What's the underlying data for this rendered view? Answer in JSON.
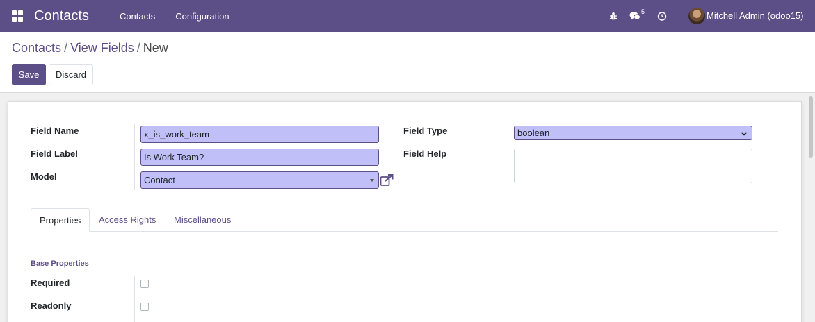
{
  "navbar": {
    "app_name": "Contacts",
    "menu": [
      "Contacts",
      "Configuration"
    ],
    "chat_count": "5",
    "user_name": "Mitchell Admin (odoo15)",
    "color": "#5c4e86"
  },
  "breadcrumb": {
    "items": [
      "Contacts",
      "View Fields"
    ],
    "separator": "/",
    "current": "New"
  },
  "actions": {
    "save_label": "Save",
    "discard_label": "Discard"
  },
  "form": {
    "field_name_label": "Field Name",
    "field_name_value": "x_is_work_team",
    "field_label_label": "Field Label",
    "field_label_value": "Is Work Team?",
    "model_label": "Model",
    "model_value": "Contact",
    "field_type_label": "Field Type",
    "field_type_value": "boolean",
    "field_help_label": "Field Help",
    "field_help_value": ""
  },
  "tabs": [
    {
      "label": "Properties",
      "active": true
    },
    {
      "label": "Access Rights",
      "active": false
    },
    {
      "label": "Miscellaneous",
      "active": false
    }
  ],
  "base_properties": {
    "title": "Base Properties",
    "required_label": "Required",
    "required_checked": false,
    "readonly_label": "Readonly",
    "readonly_checked": false
  },
  "icons": {
    "apps": "apps-grid-icon",
    "debug": "bug-icon",
    "chat": "chat-icon",
    "activity": "clock-icon",
    "external": "external-link-icon"
  }
}
